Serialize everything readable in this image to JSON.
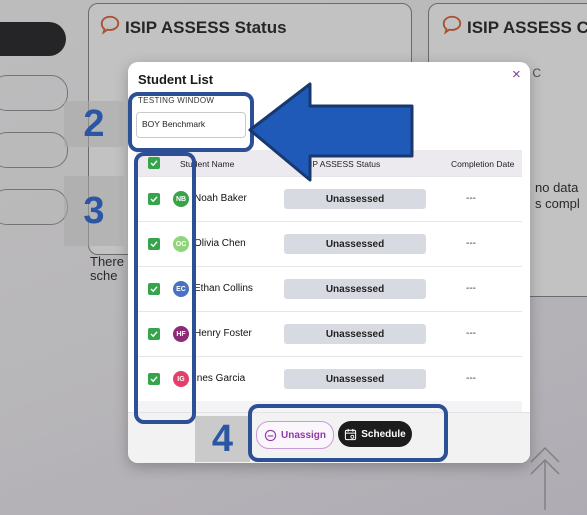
{
  "background": {
    "cards": [
      {
        "title": "ISIP ASSESS Status",
        "text_lines": [
          "There",
          "sche"
        ]
      },
      {
        "title": "ISIP ASSESS C",
        "subtitle": "SSESS C",
        "text_lines": [
          "no data",
          "s compl"
        ]
      }
    ]
  },
  "modal": {
    "title": "Student List",
    "close_icon": "×",
    "testing_window": {
      "label": "TESTING WINDOW",
      "value": "BOY Benchmark"
    },
    "table": {
      "columns": [
        "Student Name",
        "ISIP ASSESS Status",
        "Completion Date"
      ],
      "rows": [
        {
          "initials": "NB",
          "name": "Noah Baker",
          "status": "Unassessed",
          "completion": "---",
          "avatar_color": "#3aa34a",
          "checked": true
        },
        {
          "initials": "OC",
          "name": "Olivia Chen",
          "status": "Unassessed",
          "completion": "---",
          "avatar_color": "#8fd67a",
          "checked": true
        },
        {
          "initials": "EC",
          "name": "Ethan Collins",
          "status": "Unassessed",
          "completion": "---",
          "avatar_color": "#4a72c4",
          "checked": true
        },
        {
          "initials": "HF",
          "name": "Henry Foster",
          "status": "Unassessed",
          "completion": "---",
          "avatar_color": "#8e2a78",
          "checked": true
        },
        {
          "initials": "IG",
          "name": "Ines Garcia",
          "status": "Unassessed",
          "completion": "---",
          "avatar_color": "#e0406a",
          "checked": true
        }
      ]
    },
    "buttons": {
      "unassign": "Unassign",
      "schedule": "Schedule"
    }
  },
  "annotations": {
    "step2": "2",
    "step3": "3",
    "step4": "4"
  },
  "colors": {
    "accent_purple": "#8e3aa8",
    "highlight_blue": "#2c4f96",
    "check_green": "#35a44a"
  }
}
